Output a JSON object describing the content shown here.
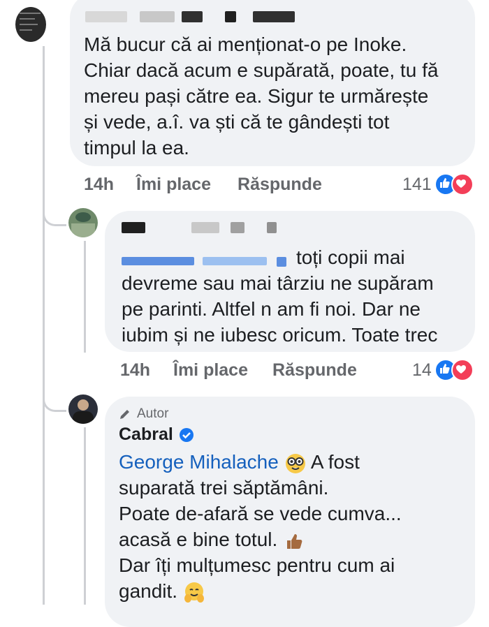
{
  "comment1": {
    "text": "Mă bucur că ai menționat-o pe Inoke. Chiar dacă acum e supărată, poate, tu fă mereu pași către ea. Sigur te urmărește și vede, a.î. va ști că te gândești tot timpul la ea.",
    "lines": [
      "Mă bucur că ai menționat-o pe Inoke.",
      "Chiar dacă acum e supărată, poate, tu fă",
      "mereu pași către ea. Sigur te urmărește",
      "și vede, a.î. va ști că te gândești tot",
      "timpul la ea."
    ],
    "time": "14h",
    "like": "Îmi place",
    "reply": "Răspunde",
    "reactions": "141"
  },
  "comment2": {
    "lines": [
      "toți copii mai",
      "devreme sau mai târziu ne supăram",
      "pe parinti. Altfel n am fi noi.  Dar ne",
      "iubim și ne iubesc oricum. Toate trec"
    ],
    "time": "14h",
    "like": "Îmi place",
    "reply": "Răspunde",
    "reactions": "14"
  },
  "comment3": {
    "badge": "Autor",
    "author": "Cabral",
    "mention": "George Mihalache",
    "line1_rest": "A fost",
    "lines": [
      "suparată trei săptămâni.",
      "Poate de-afară se vede cumva...",
      "acasă e bine totul.",
      "Dar îți mulțumesc pentru cum ai",
      "gandit."
    ]
  },
  "colors": {
    "bubble": "#f0f2f5",
    "like_blue": "#1877f2",
    "love_red": "#f33e58",
    "mention_blue": "#1560bd",
    "meta_gray": "#65676b"
  },
  "icons": [
    "pencil-icon",
    "verified-badge-icon",
    "like-reaction-icon",
    "love-reaction-icon",
    "nerd-face-emoji",
    "thumbs-up-emoji",
    "hugging-face-emoji"
  ]
}
